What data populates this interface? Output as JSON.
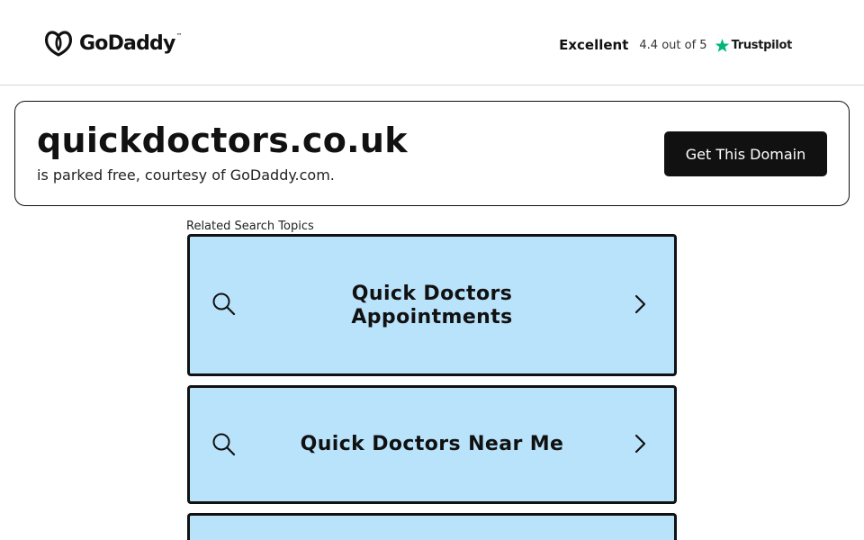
{
  "header": {
    "brand": "GoDaddy",
    "rating_word": "Excellent",
    "rating_score": "4.4 out of 5",
    "rating_provider": "Trustpilot"
  },
  "domain": {
    "name": "quickdoctors.co.uk",
    "subtitle": "is parked free, courtesy of GoDaddy.com.",
    "cta_label": "Get This Domain"
  },
  "related": {
    "label": "Related Search Topics",
    "topics": [
      {
        "line1": "Quick Doctors",
        "line2": "Appointments"
      },
      {
        "line1": "Quick Doctors Near Me",
        "line2": ""
      },
      {
        "line1": "",
        "line2": ""
      }
    ]
  },
  "colors": {
    "topic_bg": "#b9e3fb",
    "cta_bg": "#111111",
    "trustpilot_green": "#00b67a"
  },
  "icons": {
    "logo": "godaddy-logo-icon",
    "star": "trustpilot-star-icon",
    "search": "search-icon",
    "chevron": "chevron-right-icon"
  }
}
